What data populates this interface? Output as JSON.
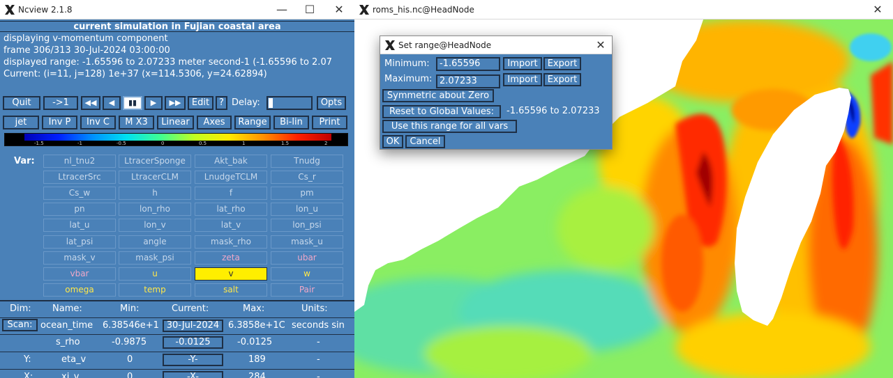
{
  "ncview": {
    "title": "Ncview 2.1.8",
    "header": "current simulation in Fujian coastal area",
    "info_lines": [
      "displaying v-momentum component",
      "frame 306/313 30-Jul-2024 03:00:00",
      "displayed range: -1.65596 to 2.07233 meter second-1 (-1.65596 to 2.07",
      "Current: (i=11, j=128) 1e+37 (x=114.5306, y=24.62894)"
    ],
    "controls": {
      "quit": "Quit",
      "jump": "->1",
      "rewind": "◀◀",
      "back": "◀",
      "pause": "▮▮",
      "forward": "▶",
      "ffwd": "▶▶",
      "edit": "Edit",
      "help": "?",
      "delay_label": "Delay:",
      "opts": "Opts"
    },
    "options": [
      "jet",
      "Inv P",
      "Inv C",
      "M X3",
      "Linear",
      "Axes",
      "Range",
      "Bi-lin",
      "Print"
    ],
    "colorbar_ticks": [
      "-1.5",
      "-1",
      "-0.5",
      "0",
      "0.5",
      "1",
      "1.5",
      "2"
    ],
    "var_label": "Var:",
    "vars": [
      "nl_tnu2",
      "LtracerSponge",
      "Akt_bak",
      "Tnudg",
      "LtracerSrc",
      "LtracerCLM",
      "LnudgeTCLM",
      "Cs_r",
      "Cs_w",
      "h",
      "f",
      "pm",
      "pn",
      "lon_rho",
      "lat_rho",
      "lon_u",
      "lat_u",
      "lon_v",
      "lat_v",
      "lon_psi",
      "lat_psi",
      "angle",
      "mask_rho",
      "mask_u",
      "mask_v",
      "mask_psi",
      "zeta",
      "ubar",
      "vbar",
      "u",
      "v",
      "w",
      "omega",
      "temp",
      "salt",
      "Pair"
    ],
    "dim_headers": {
      "dim": "Dim:",
      "name": "Name:",
      "min": "Min:",
      "current": "Current:",
      "max": "Max:",
      "units": "Units:"
    },
    "dims": [
      {
        "label": "Scan:",
        "name": "ocean_time",
        "min": "6.38546e+1",
        "current": "30-Jul-2024",
        "max": "6.3858e+1C",
        "units": "seconds sin"
      },
      {
        "label": "",
        "name": "s_rho",
        "min": "-0.9875",
        "current": "-0.0125",
        "max": "-0.0125",
        "units": "-"
      },
      {
        "label": "Y:",
        "name": "eta_v",
        "min": "0",
        "current": "-Y-",
        "max": "189",
        "units": "-"
      },
      {
        "label": "X:",
        "name": "xi_v",
        "min": "0",
        "current": "-X-",
        "max": "284",
        "units": "-"
      }
    ]
  },
  "roms": {
    "title": "roms_his.nc@HeadNode"
  },
  "dialog": {
    "title": "Set range@HeadNode",
    "minimum_label": "Minimum:",
    "minimum_value": "-1.65596",
    "maximum_label": "Maximum:",
    "maximum_value": "2.07233",
    "import_label": "Import",
    "export_label": "Export",
    "symmetric_label": "Symmetric about Zero",
    "reset_label": "Reset to Global Values:",
    "global_values": "-1.65596 to 2.07233",
    "use_all_label": "Use this range for all vars",
    "ok_label": "OK",
    "cancel_label": "Cancel"
  },
  "window_buttons": {
    "minimize": "—",
    "maximize": "☐",
    "close": "✕"
  },
  "colors": {
    "panel": "#4a81b8",
    "selected_var": "#ffee00",
    "pink_var": "#f0a8c8",
    "yellow_var": "#ffe84a"
  }
}
